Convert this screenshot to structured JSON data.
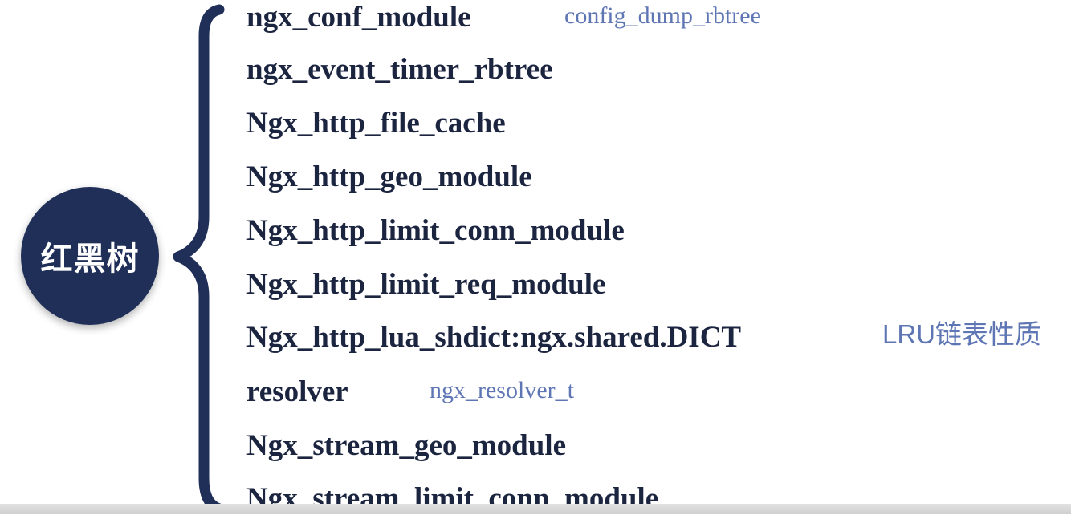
{
  "center_node": {
    "label": "红黑树"
  },
  "items": [
    {
      "text": "ngx_conf_module",
      "note": "config_dump_rbtree"
    },
    {
      "text": "ngx_event_timer_rbtree"
    },
    {
      "text": "Ngx_http_file_cache"
    },
    {
      "text": "Ngx_http_geo_module"
    },
    {
      "text": "Ngx_http_limit_conn_module"
    },
    {
      "text": "Ngx_http_limit_req_module"
    },
    {
      "text": "Ngx_http_lua_shdict:ngx.shared.DICT",
      "note": "LRU链表性质"
    },
    {
      "text": "resolver",
      "note": "ngx_resolver_t"
    },
    {
      "text": "Ngx_stream_geo_module"
    },
    {
      "text": "Ngx_stream_limit_conn_module"
    }
  ],
  "colors": {
    "node_fill": "#1f2f58",
    "item_text": "#1c2540",
    "note_text": "#5f76b5",
    "brace": "#1f2f58"
  }
}
